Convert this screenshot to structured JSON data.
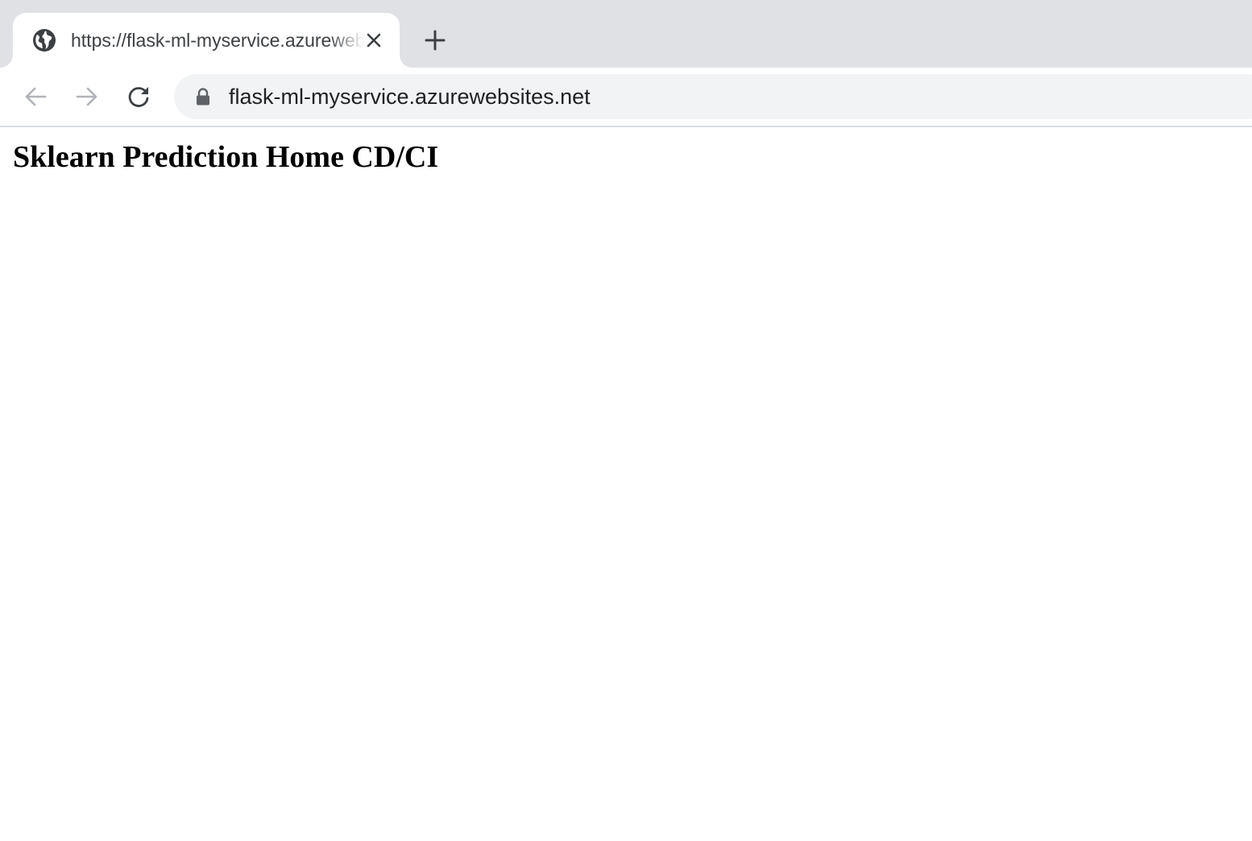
{
  "browser": {
    "tab": {
      "title": "https://flask-ml-myservice.azurewebsites.net",
      "favicon": "globe-icon",
      "close_icon": "close-icon"
    },
    "new_tab_icon": "plus-icon",
    "toolbar": {
      "back_icon": "arrow-left-icon",
      "forward_icon": "arrow-right-icon",
      "reload_icon": "reload-icon",
      "lock_icon": "lock-icon",
      "url": "flask-ml-myservice.azurewebsites.net"
    },
    "colors": {
      "tabstrip_bg": "#dfe1e5",
      "omnibox_bg": "#f1f3f4",
      "icon_dark": "#3c4043",
      "icon_disabled": "#b0b3b8"
    }
  },
  "page": {
    "heading": "Sklearn Prediction Home CD/CI"
  }
}
